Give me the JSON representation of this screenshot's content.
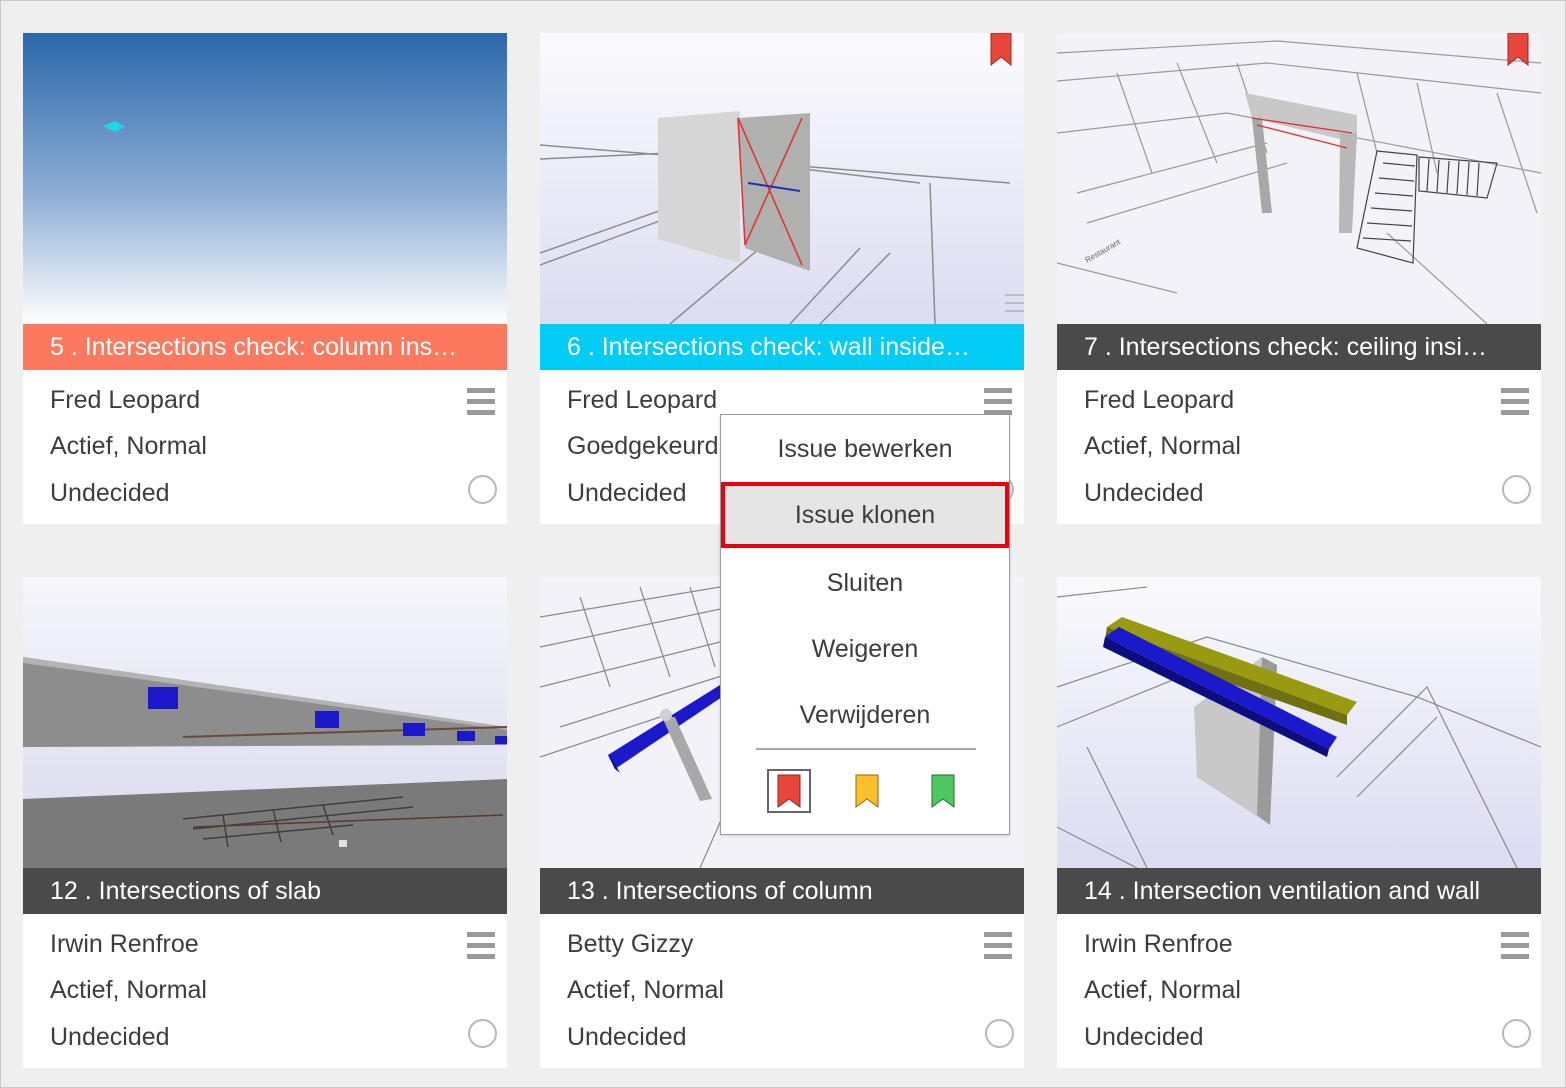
{
  "cards": [
    {
      "title": "5 . Intersections check: column ins…",
      "assignee": "Fred Leopard",
      "status": "Actief, Normal",
      "decision": "Undecided",
      "title_color": "#fb7a5f",
      "flag": null
    },
    {
      "title": "6 . Intersections check: wall inside…",
      "assignee": "Fred Leopard",
      "status": "Goedgekeurd",
      "decision": "Undecided",
      "title_color": "#00ccf5",
      "flag": "red"
    },
    {
      "title": "7 . Intersections check: ceiling insi…",
      "assignee": "Fred Leopard",
      "status": "Actief, Normal",
      "decision": "Undecided",
      "title_color": "#4a4a4a",
      "flag": "red"
    },
    {
      "title": "12 . Intersections of slab",
      "assignee": "Irwin Renfroe",
      "status": "Actief, Normal",
      "decision": "Undecided",
      "title_color": "#4a4a4a",
      "flag": null
    },
    {
      "title": "13 . Intersections of column",
      "assignee": "Betty Gizzy",
      "status": "Actief, Normal",
      "decision": "Undecided",
      "title_color": "#4a4a4a",
      "flag": null
    },
    {
      "title": "14 . Intersection ventilation and wall",
      "assignee": "Irwin Renfroe",
      "status": "Actief, Normal",
      "decision": "Undecided",
      "title_color": "#4a4a4a",
      "flag": null
    }
  ],
  "context_menu": {
    "items": [
      "Issue bewerken",
      "Issue klonen",
      "Sluiten",
      "Weigeren",
      "Verwijderen"
    ],
    "selected": "Issue klonen",
    "flags": [
      {
        "name": "red",
        "color": "#e8463a"
      },
      {
        "name": "yellow",
        "color": "#fbbe2d"
      },
      {
        "name": "green",
        "color": "#4fc65f"
      }
    ]
  },
  "icons": {
    "menu": "hamburger-icon",
    "radio": "radio-icon",
    "flag": "bookmark-flag-icon"
  }
}
